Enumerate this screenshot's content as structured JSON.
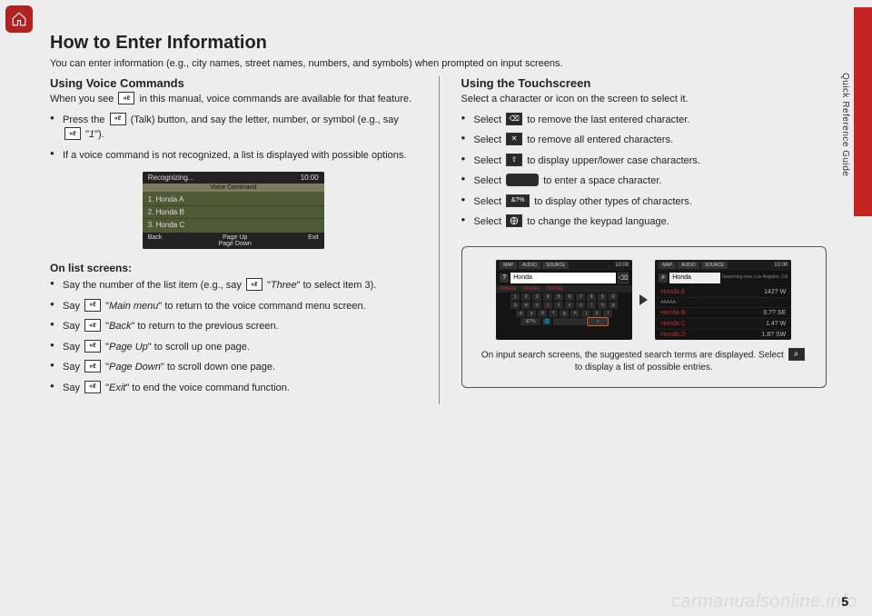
{
  "sideLabel": "Quick Reference Guide",
  "title": "How to Enter Information",
  "intro": "You can enter information (e.g., city names, street names, numbers, and symbols) when prompted on input screens.",
  "left": {
    "h2": "Using Voice Commands",
    "p1a": "When you see ",
    "p1b": " in this manual, voice commands are available for that feature.",
    "b1a": "Press the ",
    "b1b": " (Talk) button, and say the letter, number, or symbol (e.g., say ",
    "b1c": " \"",
    "b1cmd": "1",
    "b1d": "\").",
    "b2": "If a voice command is not recognized, a list is displayed with possible options.",
    "vs": {
      "recog": "Recognizing...",
      "time": "10:00",
      "bar": "Voice Command",
      "items": [
        "1. Honda A",
        "2. Honda B",
        "3. Honda C"
      ],
      "back": "Back",
      "pgup": "Page Up",
      "pgdn": "Page Down",
      "exit": "Exit"
    },
    "h3": "On list screens:",
    "list": [
      {
        "pre": "Say the number of the list item (e.g., say ",
        "cmd": "Three",
        "post": " to select item 3)."
      },
      {
        "pre": "Say ",
        "cmd": "Main menu",
        "post": " to return to the voice command menu screen."
      },
      {
        "pre": "Say ",
        "cmd": "Back",
        "post": " to return to the previous screen."
      },
      {
        "pre": "Say ",
        "cmd": "Page Up",
        "post": " to scroll up one page."
      },
      {
        "pre": "Say ",
        "cmd": "Page Down",
        "post": " to scroll down one page."
      },
      {
        "pre": "Say ",
        "cmd": "Exit",
        "post": " to end the voice command function."
      }
    ]
  },
  "right": {
    "h2": "Using the Touchscreen",
    "p1": "Select a character or icon on the screen to select it.",
    "bullets": [
      {
        "pre": "Select ",
        "icon": "backspace",
        "post": " to remove the last entered character."
      },
      {
        "pre": "Select ",
        "icon": "clear-x",
        "post": " to remove all entered characters."
      },
      {
        "pre": "Select ",
        "icon": "shift",
        "post": " to display upper/lower case characters."
      },
      {
        "pre": "Select ",
        "icon": "space",
        "post": " to enter a space character."
      },
      {
        "pre": "Select ",
        "icon": "symbols",
        "post": " to display other types of characters."
      },
      {
        "pre": "Select ",
        "icon": "globe",
        "post": " to change the keypad language."
      }
    ],
    "screens": {
      "tabs": [
        "MAP",
        "AUDIO",
        "SOURCE"
      ],
      "time": "10:00",
      "search": "Honda",
      "suggest": [
        "Honda",
        "Honda",
        "Honda"
      ],
      "kbRow1": [
        "1",
        "2",
        "3",
        "4",
        "5",
        "6",
        "7",
        "8",
        "9",
        "0"
      ],
      "kbRow2": [
        "q",
        "w",
        "e",
        "r",
        "t",
        "y",
        "u",
        "i",
        "o",
        "p"
      ],
      "kbRow3": [
        "a",
        "s",
        "d",
        "f",
        "g",
        "h",
        "j",
        "k",
        "l"
      ],
      "kbRow4l": "&?%",
      "kbRow4r": "⌕",
      "search2": "Honda",
      "searching": "Searching near Los Angeles, CA",
      "results": [
        {
          "name": "Honda A",
          "dist": "142? W"
        },
        {
          "name": "AAAAA",
          "dist": ""
        },
        {
          "name": "Honda B",
          "dist": "0.7? SE"
        },
        {
          "name": "Honda C",
          "dist": "1.4? W"
        },
        {
          "name": "Honda D",
          "dist": "1.8? SW"
        }
      ]
    },
    "caption1": "On input search screens, the suggested search terms are displayed. Select ",
    "caption2": " to display a list of possible entries."
  },
  "watermark": "carmanualsonline.info",
  "pageNum": "5"
}
